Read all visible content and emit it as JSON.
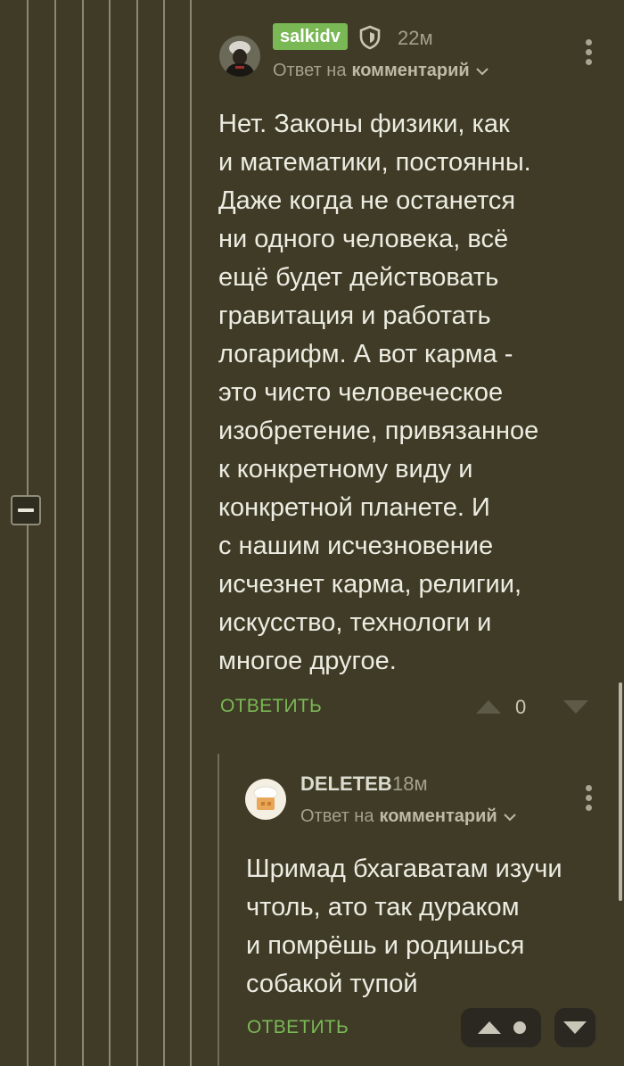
{
  "comments": [
    {
      "author": "salkidv",
      "time": "22м",
      "reply_prefix": "Ответ на",
      "reply_target": "комментарий",
      "body": "Нет. Законы физики, как\nи математики, постоянны.\nДаже когда не останется\nни одного человека, всё\nещё будет действовать\nгравитация и работать\nлогарифм. А вот карма -\nэто чисто человеческое\nизобретение, привязанное\nк конкретному виду и\nконкретной планете. И\nс нашим исчезновение\nисчезнет карма, религии,\nискусство, технологи и\nмногое другое.",
      "reply_label": "ОТВЕТИТЬ",
      "rating": "0"
    },
    {
      "author": "DELETEB",
      "time": "18м",
      "reply_prefix": "Ответ на",
      "reply_target": "комментарий",
      "body": "Шримад бхагаватам изучи\nчтоль, ато так дураком\nи помрёшь и родишься\nсобакой тупой",
      "reply_label": "ОТВЕТИТЬ"
    }
  ],
  "colors": {
    "background": "#3f3b26",
    "accent_green": "#7ab856",
    "thread_line": "#8a8772"
  },
  "icons": {
    "collapse": "minus-icon",
    "shield": "shield-icon",
    "more": "kebab-menu-icon",
    "upvote": "triangle-up-icon",
    "downvote": "triangle-down-icon",
    "dropdown": "chevron-down-icon"
  }
}
